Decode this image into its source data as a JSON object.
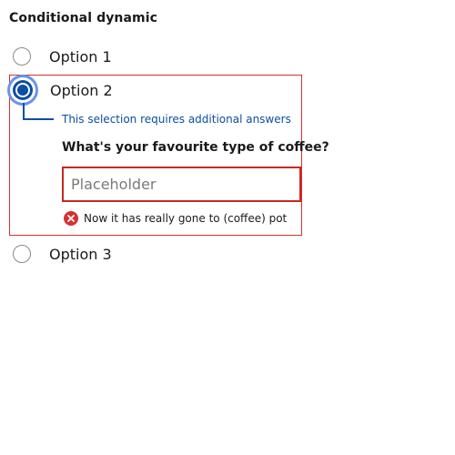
{
  "group": {
    "title": "Conditional dynamic"
  },
  "options": [
    {
      "label": "Option 1",
      "selected": false
    },
    {
      "label": "Option 2",
      "selected": true
    },
    {
      "label": "Option 3",
      "selected": false
    }
  ],
  "conditional": {
    "hint": "This selection requires additional answers",
    "question": "What's your favourite type of coffee?",
    "input": {
      "value": "",
      "placeholder": "Placeholder"
    },
    "error": {
      "message": "Now it has really gone to (coffee) pot",
      "icon": "error-circle-x-icon"
    }
  },
  "colors": {
    "selected_accent": "#0b4ea2",
    "focus_ring": "#6b93e8",
    "error_border": "#d8302f",
    "error_icon": "#d8302f",
    "hint_text": "#0b4ea2"
  }
}
